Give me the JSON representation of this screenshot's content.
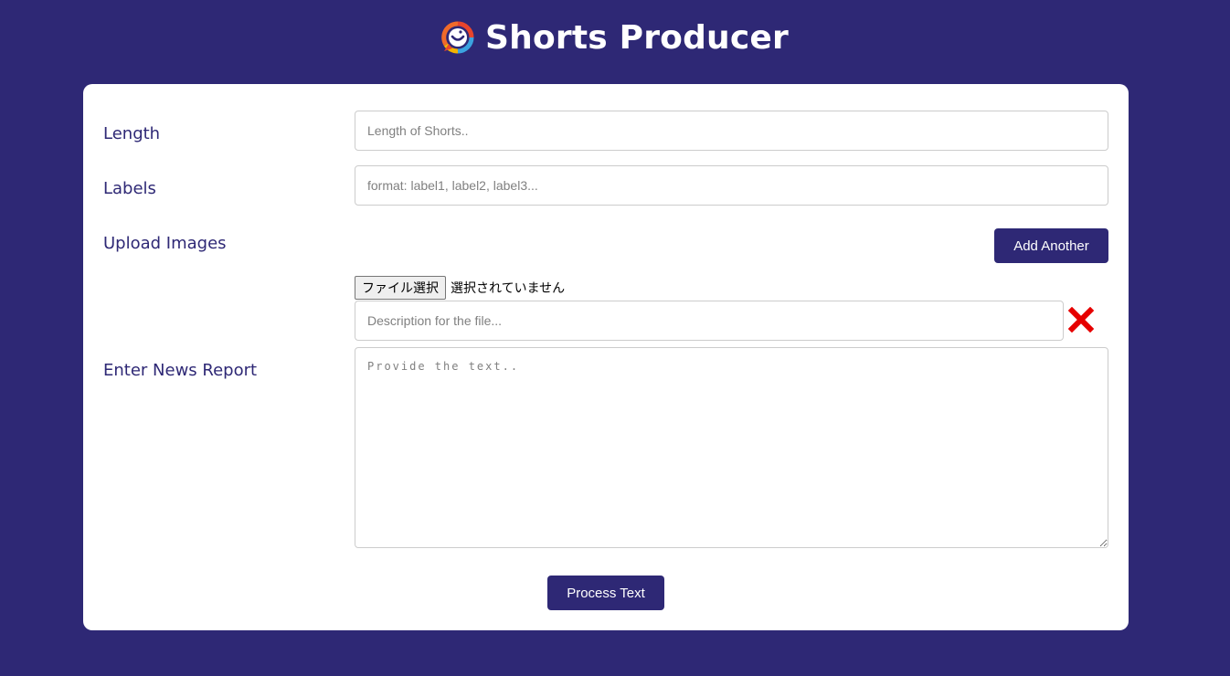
{
  "header": {
    "title": "Shorts Producer",
    "logo_icon": "chat-bubble-smile-icon"
  },
  "form": {
    "length": {
      "label": "Length",
      "placeholder": "Length of Shorts.."
    },
    "labels": {
      "label": "Labels",
      "placeholder": "format: label1, label2, label3..."
    },
    "upload": {
      "label": "Upload Images",
      "add_button": "Add Another",
      "file_button": "ファイル選択",
      "file_status": "選択されていません",
      "description_placeholder": "Description for the file...",
      "remove_icon": "red-x-icon"
    },
    "news": {
      "label": "Enter News Report",
      "placeholder": "Provide the text.."
    },
    "submit": "Process Text"
  },
  "colors": {
    "background": "#2e2875",
    "accent": "#2e2875",
    "remove": "#e60000"
  }
}
